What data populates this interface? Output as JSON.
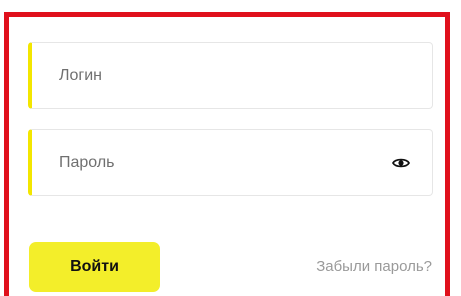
{
  "form": {
    "login_field": {
      "placeholder": "Логин",
      "value": ""
    },
    "password_field": {
      "placeholder": "Пароль",
      "value": "",
      "toggle_icon": "eye-icon"
    },
    "submit_label": "Войти",
    "forgot_password_label": "Забыли пароль?"
  },
  "colors": {
    "frame_border": "#e0101c",
    "accent_yellow": "#f3ee2a",
    "field_accent": "#f3e600",
    "link_gray": "#9a9a9a"
  }
}
